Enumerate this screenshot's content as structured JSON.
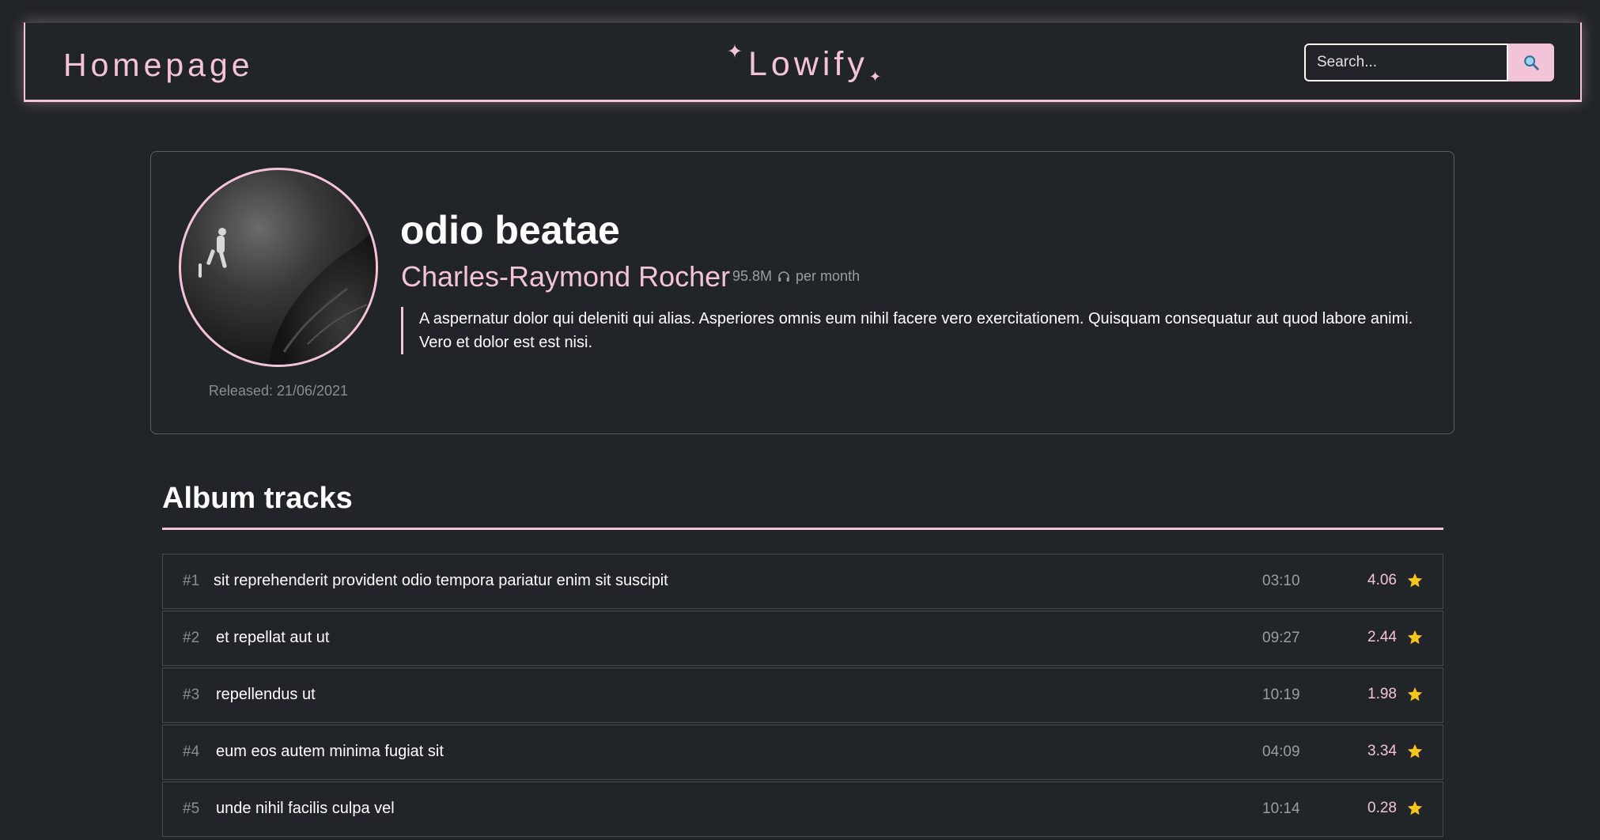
{
  "nav": {
    "home_label": "Homepage",
    "brand": "Lowify",
    "sparkle_glyph": "✦",
    "search_placeholder": "Search..."
  },
  "album": {
    "title": "odio beatae",
    "artist": "Charles-Raymond Rocher",
    "monthly_listeners": "95.8M",
    "listeners_suffix": "per month",
    "description": "A aspernatur dolor qui deleniti qui alias. Asperiores omnis eum nihil facere vero exercitationem. Quisquam consequatur aut quod labore animi. Vero et dolor est est nisi.",
    "released": "Released: 21/06/2021"
  },
  "tracks_section": {
    "title": "Album tracks"
  },
  "tracks": [
    {
      "num": "#1",
      "name": "sit reprehenderit provident odio tempora pariatur enim sit suscipit",
      "duration": "03:10",
      "rating": "4.06"
    },
    {
      "num": "#2",
      "name": "et repellat aut ut",
      "duration": "09:27",
      "rating": "2.44"
    },
    {
      "num": "#3",
      "name": "repellendus ut",
      "duration": "10:19",
      "rating": "1.98"
    },
    {
      "num": "#4",
      "name": "eum eos autem minima fugiat sit",
      "duration": "04:09",
      "rating": "3.34"
    },
    {
      "num": "#5",
      "name": "unde nihil facilis culpa vel",
      "duration": "10:14",
      "rating": "0.28"
    }
  ],
  "colors": {
    "background": "#212429",
    "accent_pink": "#f3c4d8",
    "star_gold": "#f5c518"
  },
  "icons": {
    "search": "search-icon",
    "headphones": "headphones-icon",
    "star": "star-icon"
  }
}
